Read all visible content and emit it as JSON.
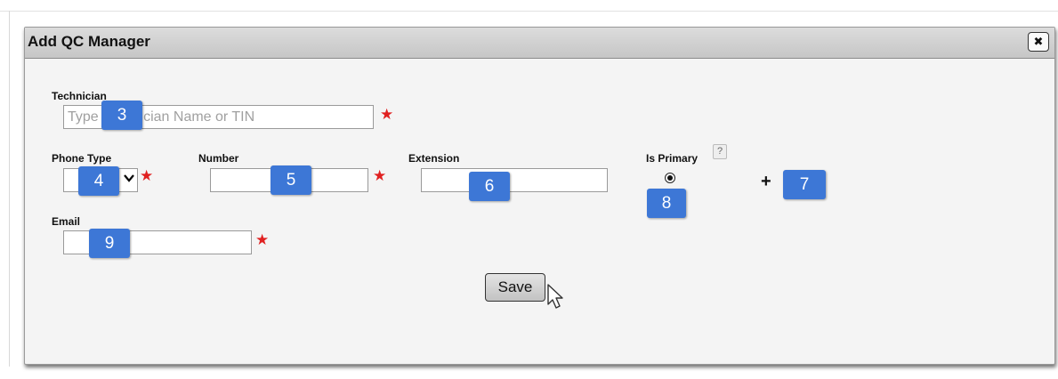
{
  "dialog": {
    "title": "Add QC Manager",
    "close_icon": "close-icon",
    "close_glyph": "✖"
  },
  "form": {
    "technician": {
      "label": "Technician",
      "placeholder": "Type Technician Name or TIN",
      "value": ""
    },
    "phone_type": {
      "label": "Phone Type",
      "value": ""
    },
    "number": {
      "label": "Number",
      "value": ""
    },
    "extension": {
      "label": "Extension",
      "value": ""
    },
    "is_primary": {
      "label": "Is Primary",
      "help": "?",
      "selected": true
    },
    "add": {
      "label": "+"
    },
    "email": {
      "label": "Email",
      "value": ""
    },
    "required_marker": "★",
    "save_label": "Save"
  },
  "annotations": {
    "badge_3": "3",
    "badge_4": "4",
    "badge_5": "5",
    "badge_6": "6",
    "badge_7": "7",
    "badge_8": "8",
    "badge_9": "9"
  },
  "colors": {
    "badge": "#3d77d6",
    "required": "#e02020"
  }
}
